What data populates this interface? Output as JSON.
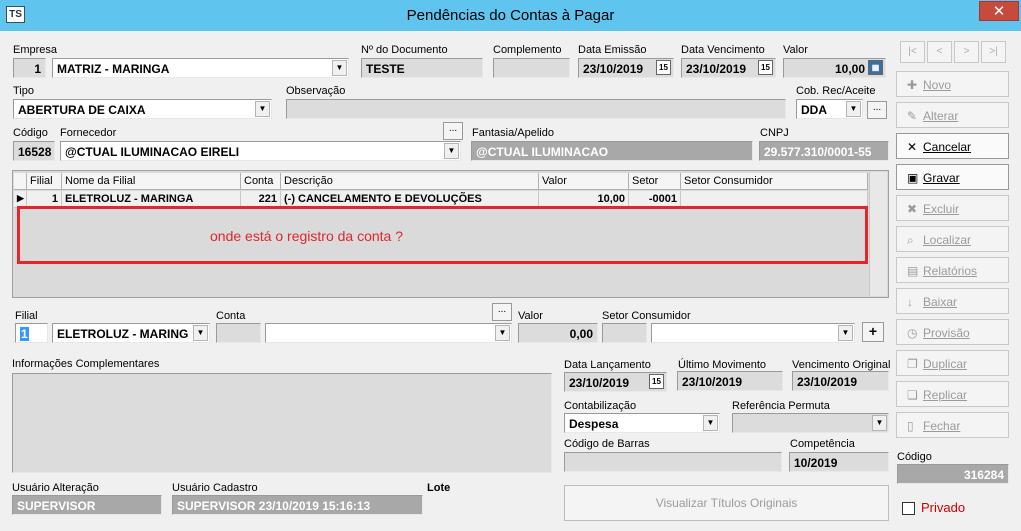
{
  "window": {
    "title": "Pendências do Contas à Pagar",
    "icon_text": "TS",
    "close_glyph": "✕"
  },
  "labels": {
    "empresa": "Empresa",
    "num_documento": "Nº do Documento",
    "complemento": "Complemento",
    "data_emissao": "Data Emissão",
    "data_vencimento": "Data Vencimento",
    "valor": "Valor",
    "tipo": "Tipo",
    "observacao": "Observação",
    "cob_rec_aceite": "Cob. Rec/Aceite",
    "codigo": "Código",
    "fornecedor": "Fornecedor",
    "fantasia": "Fantasia/Apelido",
    "cnpj": "CNPJ",
    "filial": "Filial",
    "conta": "Conta",
    "valor2": "Valor",
    "setor_consumidor": "Setor Consumidor",
    "info_complementares": "Informações Complementares",
    "data_lancamento": "Data Lançamento",
    "ultimo_movimento": "Último Movimento",
    "vencimento_original": "Vencimento Original",
    "contabilizacao": "Contabilização",
    "referencia_permuta": "Referência Permuta",
    "codigo_barras": "Código de Barras",
    "competencia": "Competência",
    "codigo_side": "Código",
    "usuario_alteracao": "Usuário Alteração",
    "usuario_cadastro": "Usuário Cadastro",
    "lote": "Lote"
  },
  "fields": {
    "empresa_num": "1",
    "empresa_nome": "MATRIZ - MARINGA",
    "num_documento": "TESTE",
    "complemento": "",
    "data_emissao": "23/10/2019",
    "data_vencimento": "23/10/2019",
    "valor": "10,00",
    "tipo": "ABERTURA DE CAIXA",
    "observacao": "",
    "cob_rec_aceite": "DDA",
    "codigo": "16528",
    "fornecedor": "@CTUAL ILUMINACAO EIRELI",
    "fantasia": "@CTUAL ILUMINACAO",
    "cnpj": "29.577.310/0001-55",
    "filial_num": "1",
    "filial_nome": "ELETROLUZ - MARING",
    "conta_num": "",
    "conta_nome": "",
    "valor2": "0,00",
    "setor_num": "",
    "setor_nome": "",
    "data_lancamento": "23/10/2019",
    "ultimo_movimento": "23/10/2019",
    "vencimento_original": "23/10/2019",
    "contabilizacao": "Despesa",
    "referencia_permuta": "",
    "codigo_barras": "",
    "competencia": "10/2019",
    "codigo_side": "316284",
    "usuario_alteracao": "SUPERVISOR",
    "usuario_cadastro": "SUPERVISOR 23/10/2019 15:16:13"
  },
  "grid": {
    "headers": [
      "Filial",
      "Nome da Filial",
      "Conta",
      "Descrição",
      "Valor",
      "Setor",
      "Setor Consumidor"
    ],
    "rows": [
      {
        "filial": "1",
        "nome": "ELETROLUZ - MARINGA",
        "conta": "221",
        "descricao": "(-) CANCELAMENTO E DEVOLUÇÕES",
        "valor": "10,00",
        "setor": "-0001",
        "setor_consumidor": ""
      }
    ]
  },
  "annotation": {
    "text": "onde está o registro da conta ?",
    "color": "#e2262c"
  },
  "toolbar": {
    "nav": [
      "|<",
      "<",
      ">",
      ">|"
    ],
    "buttons": [
      {
        "label": "Novo",
        "icon": "new-icon",
        "glyph": "✚",
        "enabled": false
      },
      {
        "label": "Alterar",
        "icon": "edit-icon",
        "glyph": "✎",
        "enabled": false
      },
      {
        "label": "Cancelar",
        "icon": "cancel-icon",
        "glyph": "✕",
        "enabled": true
      },
      {
        "label": "Gravar",
        "icon": "save-icon",
        "glyph": "▣",
        "enabled": true
      },
      {
        "label": "Excluir",
        "icon": "trash-icon",
        "glyph": "✖",
        "enabled": false
      },
      {
        "label": "Localizar",
        "icon": "search-icon",
        "glyph": "⌕",
        "enabled": false
      },
      {
        "label": "Relatórios",
        "icon": "printer-icon",
        "glyph": "▤",
        "enabled": false
      },
      {
        "label": "Baixar",
        "icon": "download-icon",
        "glyph": "↓",
        "enabled": false
      },
      {
        "label": "Provisão",
        "icon": "clock-icon",
        "glyph": "◷",
        "enabled": false
      },
      {
        "label": "Duplicar",
        "icon": "duplicate-icon",
        "glyph": "❐",
        "enabled": false
      },
      {
        "label": "Replicar",
        "icon": "replicate-icon",
        "glyph": "❏",
        "enabled": false
      },
      {
        "label": "Fechar",
        "icon": "close-doc-icon",
        "glyph": "▯",
        "enabled": false
      }
    ]
  },
  "buttons": {
    "visualizar": "Visualizar Títulos Originais",
    "ellipsis": "...",
    "plus": "+"
  },
  "privado": {
    "label": "Privado",
    "checked": false
  },
  "colors": {
    "titlebar": "#5fc4ee",
    "close": "#c74b3d",
    "accent_red": "#d00000"
  }
}
